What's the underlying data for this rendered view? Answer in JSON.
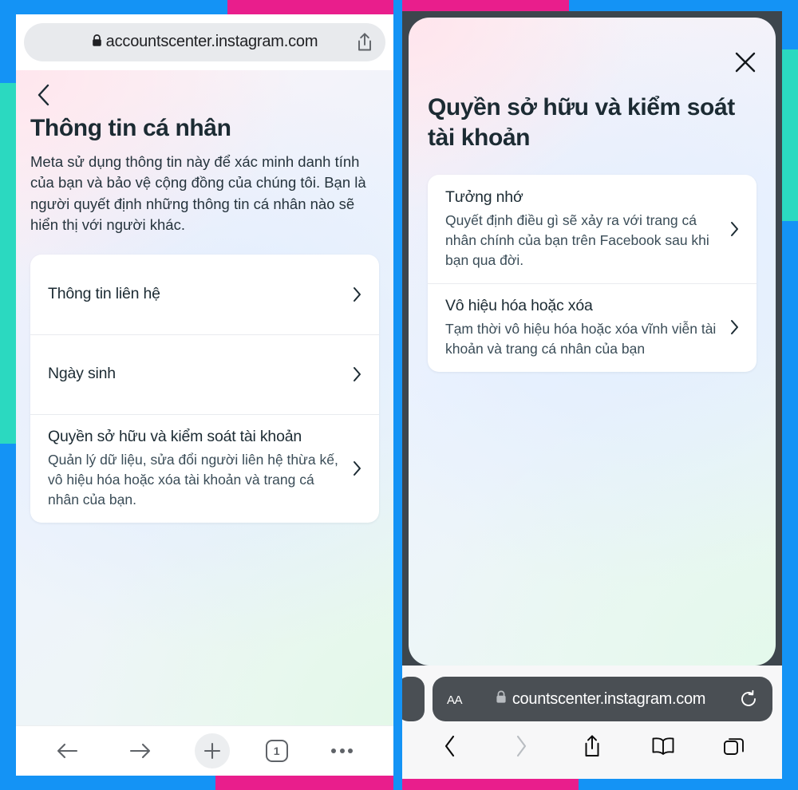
{
  "left_phone": {
    "browser": "chrome-ios",
    "address_bar": {
      "url": "accountscenter.instagram.com",
      "lock_icon": "lock-icon",
      "share_icon": "share-icon"
    },
    "page": {
      "back_icon": "chevron-left-icon",
      "title": "Thông tin cá nhân",
      "description": "Meta sử dụng thông tin này để xác minh danh tính của bạn và bảo vệ cộng đồng của chúng tôi. Bạn là người quyết định những thông tin cá nhân nào sẽ hiển thị với người khác.",
      "rows": [
        {
          "title": "Thông tin liên hệ",
          "subtitle": "",
          "chevron": "chevron-right-icon"
        },
        {
          "title": "Ngày sinh",
          "subtitle": "",
          "chevron": "chevron-right-icon"
        },
        {
          "title": "Quyền sở hữu và kiểm soát tài khoản",
          "subtitle": "Quản lý dữ liệu, sửa đổi người liên hệ thừa kế, vô hiệu hóa hoặc xóa tài khoản và trang cá nhân của bạn.",
          "chevron": "chevron-right-icon"
        }
      ]
    },
    "toolbar": {
      "back_icon": "arrow-left-icon",
      "forward_icon": "arrow-right-icon",
      "new_tab_icon": "plus-icon",
      "tab_count": "1",
      "menu_icon": "more-horizontal-icon"
    }
  },
  "right_phone": {
    "browser": "safari-ios",
    "sheet": {
      "close_icon": "close-x-icon",
      "title": "Quyền sở hữu và kiểm soát tài khoản",
      "rows": [
        {
          "title": "Tưởng nhớ",
          "subtitle": "Quyết định điều gì sẽ xảy ra với trang cá nhân chính của bạn trên Facebook sau khi bạn qua đời.",
          "chevron": "chevron-right-icon"
        },
        {
          "title": "Vô hiệu hóa hoặc xóa",
          "subtitle": "Tạm thời vô hiệu hóa hoặc xóa vĩnh viễn tài khoản và trang cá nhân của bạn",
          "chevron": "chevron-right-icon"
        }
      ]
    },
    "address_bar": {
      "page_settings_label": "AA",
      "lock_icon": "lock-icon",
      "url": "countscenter.instagram.com",
      "reload_icon": "reload-icon"
    },
    "toolbar": {
      "back_icon": "chevron-left-icon",
      "forward_icon": "chevron-right-icon",
      "share_icon": "share-icon",
      "bookmarks_icon": "book-icon",
      "tabs_icon": "tabs-icon"
    }
  },
  "decor": {
    "blue": "#1493f5",
    "pink": "#e91e8c",
    "teal": "#2bd9c0"
  }
}
